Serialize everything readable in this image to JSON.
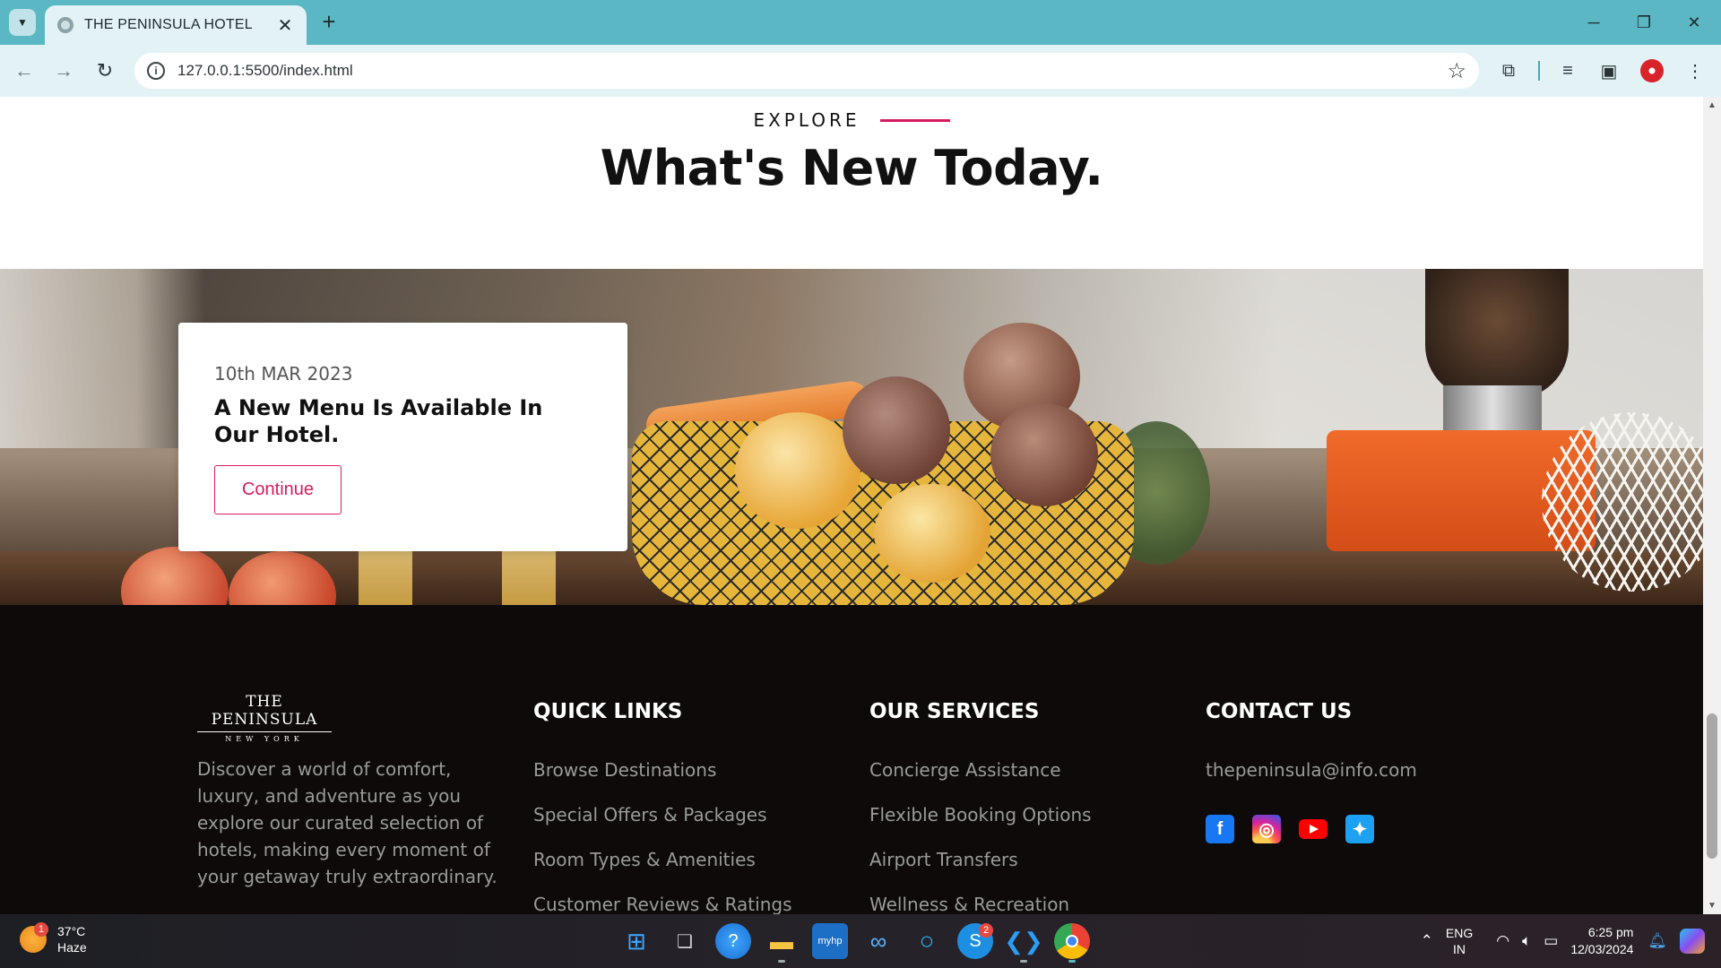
{
  "browser": {
    "tab_title": "THE PENINSULA HOTEL",
    "tab_close": "✕",
    "new_tab": "+",
    "url": "127.0.0.1:5500/index.html",
    "window_controls": {
      "minimize": "─",
      "restore": "❐",
      "close": "✕"
    }
  },
  "page": {
    "eyebrow": "EXPLORE",
    "title": "What's New Today.",
    "news": {
      "date": "10th MAR 2023",
      "headline": "A New Menu Is Available In Our Hotel.",
      "button_label": "Continue"
    },
    "footer": {
      "logo_main": "THE PENINSULA",
      "logo_sub": "NEW YORK",
      "description": "Discover a world of comfort, luxury, and adventure as you explore our curated selection of hotels, making every moment of your getaway truly extraordinary.",
      "quick_links": {
        "heading": "QUICK LINKS",
        "items": [
          "Browse Destinations",
          "Special Offers & Packages",
          "Room Types & Amenities",
          "Customer Reviews & Ratings"
        ]
      },
      "services": {
        "heading": "OUR SERVICES",
        "items": [
          "Concierge Assistance",
          "Flexible Booking Options",
          "Airport Transfers",
          "Wellness & Recreation"
        ]
      },
      "contact": {
        "heading": "CONTACT US",
        "email": "thepeninsula@info.com",
        "social": [
          "facebook-icon",
          "instagram-icon",
          "youtube-icon",
          "twitter-icon"
        ]
      }
    },
    "accent_color": "#d81b60"
  },
  "taskbar": {
    "weather": {
      "badge": "1",
      "temp": "37°C",
      "condition": "Haze"
    },
    "skype_badge": "2",
    "language": {
      "line1": "ENG",
      "line2": "IN"
    },
    "clock": {
      "time": "6:25 pm",
      "date": "12/03/2024"
    }
  }
}
